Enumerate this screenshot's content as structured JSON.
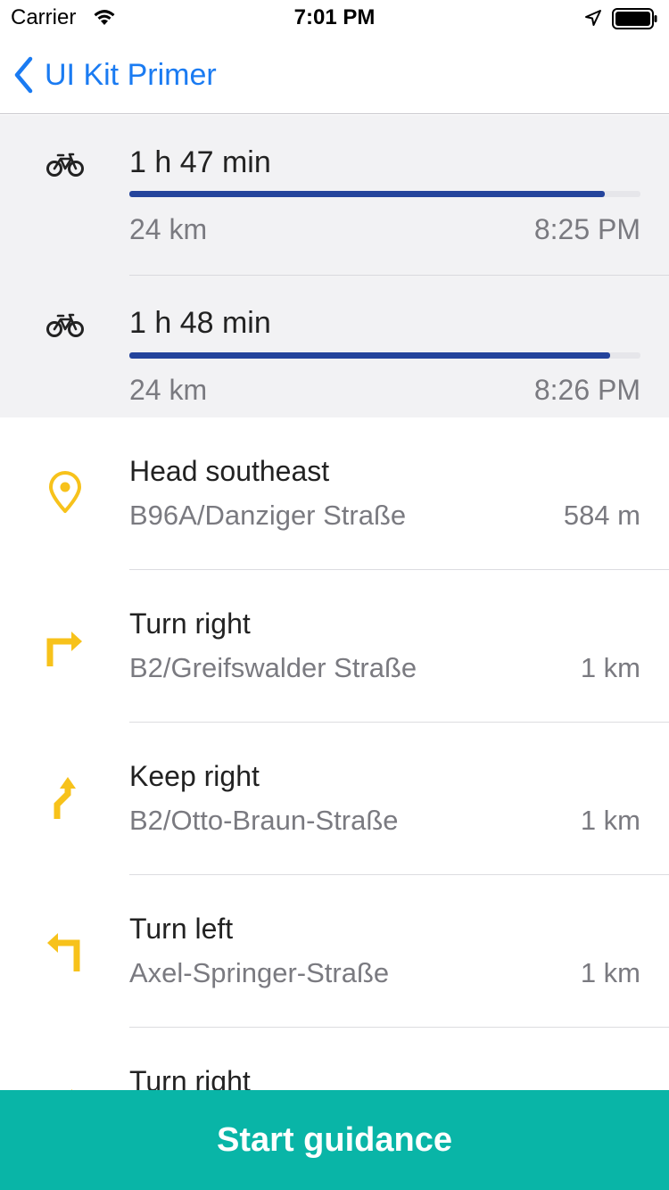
{
  "status_bar": {
    "carrier": "Carrier",
    "time": "7:01 PM",
    "icons": [
      "wifi-icon",
      "location-arrow-icon",
      "battery-icon"
    ]
  },
  "nav": {
    "back_label": "UI Kit Primer",
    "accent_color": "#1a7bf2"
  },
  "routes": [
    {
      "mode_icon": "bicycle-icon",
      "duration": "1 h 47 min",
      "distance": "24 km",
      "eta": "8:25 PM",
      "progress": 0.93
    },
    {
      "mode_icon": "bicycle-icon",
      "duration": "1 h 48 min",
      "distance": "24 km",
      "eta": "8:26 PM",
      "progress": 0.94
    }
  ],
  "maneuvers": [
    {
      "icon": "location-pin-icon",
      "title": "Head southeast",
      "street": "B96A/Danziger Straße",
      "distance": "584 m"
    },
    {
      "icon": "turn-right-icon",
      "title": "Turn right",
      "street": "B2/Greifswalder Straße",
      "distance": "1 km"
    },
    {
      "icon": "keep-right-icon",
      "title": "Keep right",
      "street": "B2/Otto-Braun-Straße",
      "distance": "1 km"
    },
    {
      "icon": "turn-left-icon",
      "title": "Turn left",
      "street": "Axel-Springer-Straße",
      "distance": "1 km"
    },
    {
      "icon": "turn-right-icon",
      "title": "Turn right",
      "street": "",
      "distance": ""
    }
  ],
  "start_button": {
    "label": "Start guidance",
    "color": "#09b5a7"
  },
  "colors": {
    "route_bar": "#24449c",
    "maneuver_icon": "#f7c21b"
  }
}
